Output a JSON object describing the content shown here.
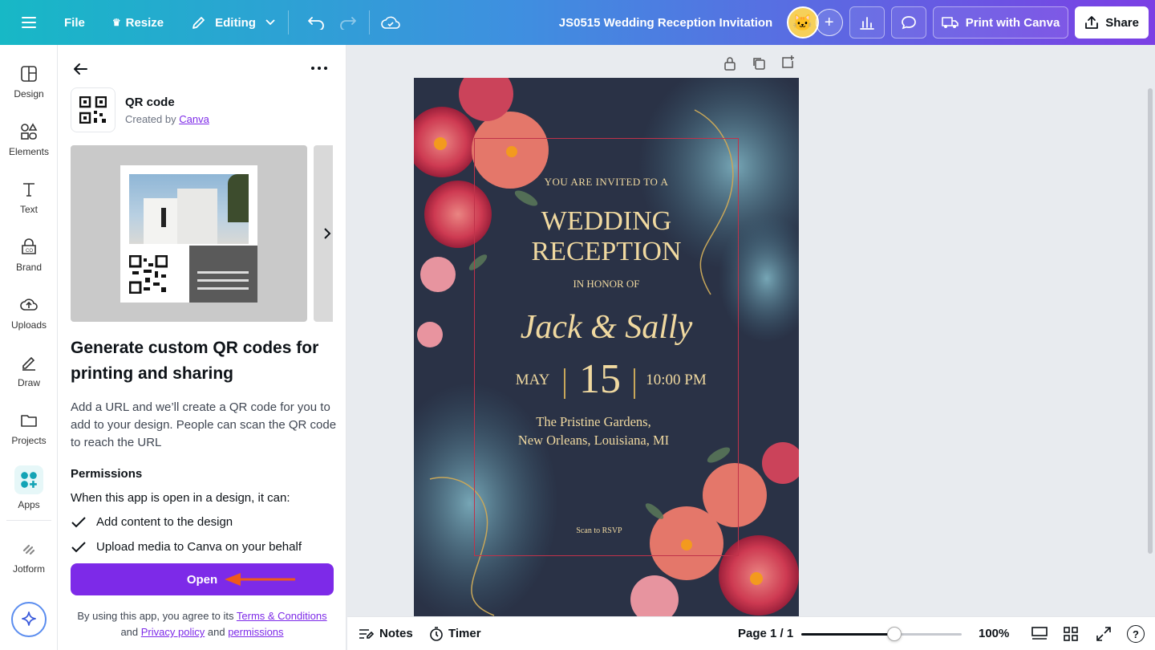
{
  "topbar": {
    "file_label": "File",
    "resize_label": "Resize",
    "editing_label": "Editing",
    "doc_title": "JS0515 Wedding Reception Invitation",
    "print_label": "Print with Canva",
    "share_label": "Share"
  },
  "rail": {
    "items": [
      {
        "label": "Design"
      },
      {
        "label": "Elements"
      },
      {
        "label": "Text"
      },
      {
        "label": "Brand"
      },
      {
        "label": "Uploads"
      },
      {
        "label": "Draw"
      },
      {
        "label": "Projects"
      },
      {
        "label": "Apps"
      },
      {
        "label": "Jotform"
      }
    ]
  },
  "panel": {
    "app_name": "QR code",
    "created_by_prefix": "Created by",
    "created_by_link": "Canva",
    "heading": "Generate custom QR codes for printing and sharing",
    "description": "Add a URL and we’ll create a QR code for you to add to your design. People can scan the QR code to reach the URL",
    "permissions_title": "Permissions",
    "permissions_intro": "When this app is open in a design, it can:",
    "permissions": [
      "Add content to the design",
      "Upload media to Canva on your behalf"
    ],
    "open_label": "Open",
    "terms_prefix": "By using this app, you agree to its",
    "terms_link": "Terms & Conditions",
    "and1": "and",
    "privacy_link": "Privacy policy",
    "and2": "and",
    "permissions_link": "permissions"
  },
  "invitation": {
    "line1": "YOU ARE INVITED TO A",
    "title1": "WEDDING",
    "title2": "RECEPTION",
    "honor": "IN HONOR OF",
    "names": "Jack & Sally",
    "month": "MAY",
    "day": "15",
    "time": "10:00 PM",
    "venue1": "The Pristine Gardens,",
    "venue2": "New Orleans, Louisiana, MI",
    "rsvp": "Scan to RSVP"
  },
  "bottombar": {
    "notes_label": "Notes",
    "timer_label": "Timer",
    "page_label": "Page 1 / 1",
    "zoom": "100%",
    "zoom_fraction": 0.58
  },
  "colors": {
    "accent": "#7d2ae8",
    "card_bg": "#2a3246",
    "gold": "#f0d9a0",
    "frame": "#c0324a"
  }
}
